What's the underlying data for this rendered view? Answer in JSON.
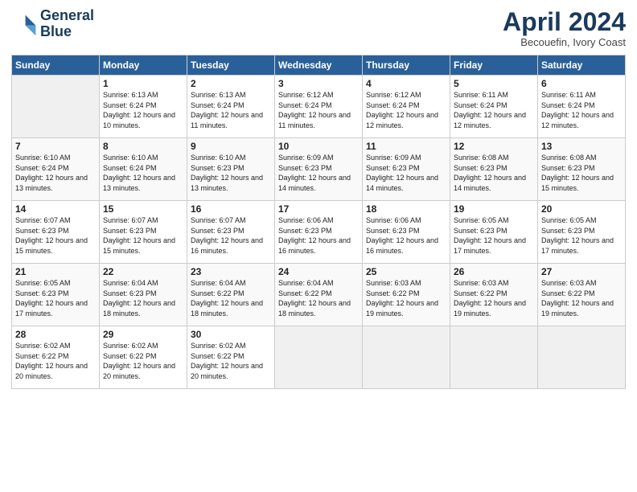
{
  "logo": {
    "line1": "General",
    "line2": "Blue"
  },
  "title": "April 2024",
  "location": "Becouefin, Ivory Coast",
  "days_of_week": [
    "Sunday",
    "Monday",
    "Tuesday",
    "Wednesday",
    "Thursday",
    "Friday",
    "Saturday"
  ],
  "weeks": [
    [
      {
        "day": "",
        "empty": true
      },
      {
        "day": "1",
        "sunrise": "6:13 AM",
        "sunset": "6:24 PM",
        "daylight": "12 hours and 10 minutes."
      },
      {
        "day": "2",
        "sunrise": "6:13 AM",
        "sunset": "6:24 PM",
        "daylight": "12 hours and 11 minutes."
      },
      {
        "day": "3",
        "sunrise": "6:12 AM",
        "sunset": "6:24 PM",
        "daylight": "12 hours and 11 minutes."
      },
      {
        "day": "4",
        "sunrise": "6:12 AM",
        "sunset": "6:24 PM",
        "daylight": "12 hours and 12 minutes."
      },
      {
        "day": "5",
        "sunrise": "6:11 AM",
        "sunset": "6:24 PM",
        "daylight": "12 hours and 12 minutes."
      },
      {
        "day": "6",
        "sunrise": "6:11 AM",
        "sunset": "6:24 PM",
        "daylight": "12 hours and 12 minutes."
      }
    ],
    [
      {
        "day": "7",
        "sunrise": "6:10 AM",
        "sunset": "6:24 PM",
        "daylight": "12 hours and 13 minutes."
      },
      {
        "day": "8",
        "sunrise": "6:10 AM",
        "sunset": "6:24 PM",
        "daylight": "12 hours and 13 minutes."
      },
      {
        "day": "9",
        "sunrise": "6:10 AM",
        "sunset": "6:23 PM",
        "daylight": "12 hours and 13 minutes."
      },
      {
        "day": "10",
        "sunrise": "6:09 AM",
        "sunset": "6:23 PM",
        "daylight": "12 hours and 14 minutes."
      },
      {
        "day": "11",
        "sunrise": "6:09 AM",
        "sunset": "6:23 PM",
        "daylight": "12 hours and 14 minutes."
      },
      {
        "day": "12",
        "sunrise": "6:08 AM",
        "sunset": "6:23 PM",
        "daylight": "12 hours and 14 minutes."
      },
      {
        "day": "13",
        "sunrise": "6:08 AM",
        "sunset": "6:23 PM",
        "daylight": "12 hours and 15 minutes."
      }
    ],
    [
      {
        "day": "14",
        "sunrise": "6:07 AM",
        "sunset": "6:23 PM",
        "daylight": "12 hours and 15 minutes."
      },
      {
        "day": "15",
        "sunrise": "6:07 AM",
        "sunset": "6:23 PM",
        "daylight": "12 hours and 15 minutes."
      },
      {
        "day": "16",
        "sunrise": "6:07 AM",
        "sunset": "6:23 PM",
        "daylight": "12 hours and 16 minutes."
      },
      {
        "day": "17",
        "sunrise": "6:06 AM",
        "sunset": "6:23 PM",
        "daylight": "12 hours and 16 minutes."
      },
      {
        "day": "18",
        "sunrise": "6:06 AM",
        "sunset": "6:23 PM",
        "daylight": "12 hours and 16 minutes."
      },
      {
        "day": "19",
        "sunrise": "6:05 AM",
        "sunset": "6:23 PM",
        "daylight": "12 hours and 17 minutes."
      },
      {
        "day": "20",
        "sunrise": "6:05 AM",
        "sunset": "6:23 PM",
        "daylight": "12 hours and 17 minutes."
      }
    ],
    [
      {
        "day": "21",
        "sunrise": "6:05 AM",
        "sunset": "6:23 PM",
        "daylight": "12 hours and 17 minutes."
      },
      {
        "day": "22",
        "sunrise": "6:04 AM",
        "sunset": "6:23 PM",
        "daylight": "12 hours and 18 minutes."
      },
      {
        "day": "23",
        "sunrise": "6:04 AM",
        "sunset": "6:22 PM",
        "daylight": "12 hours and 18 minutes."
      },
      {
        "day": "24",
        "sunrise": "6:04 AM",
        "sunset": "6:22 PM",
        "daylight": "12 hours and 18 minutes."
      },
      {
        "day": "25",
        "sunrise": "6:03 AM",
        "sunset": "6:22 PM",
        "daylight": "12 hours and 19 minutes."
      },
      {
        "day": "26",
        "sunrise": "6:03 AM",
        "sunset": "6:22 PM",
        "daylight": "12 hours and 19 minutes."
      },
      {
        "day": "27",
        "sunrise": "6:03 AM",
        "sunset": "6:22 PM",
        "daylight": "12 hours and 19 minutes."
      }
    ],
    [
      {
        "day": "28",
        "sunrise": "6:02 AM",
        "sunset": "6:22 PM",
        "daylight": "12 hours and 20 minutes."
      },
      {
        "day": "29",
        "sunrise": "6:02 AM",
        "sunset": "6:22 PM",
        "daylight": "12 hours and 20 minutes."
      },
      {
        "day": "30",
        "sunrise": "6:02 AM",
        "sunset": "6:22 PM",
        "daylight": "12 hours and 20 minutes."
      },
      {
        "day": "",
        "empty": true
      },
      {
        "day": "",
        "empty": true
      },
      {
        "day": "",
        "empty": true
      },
      {
        "day": "",
        "empty": true
      }
    ]
  ],
  "labels": {
    "sunrise": "Sunrise:",
    "sunset": "Sunset:",
    "daylight": "Daylight:"
  }
}
